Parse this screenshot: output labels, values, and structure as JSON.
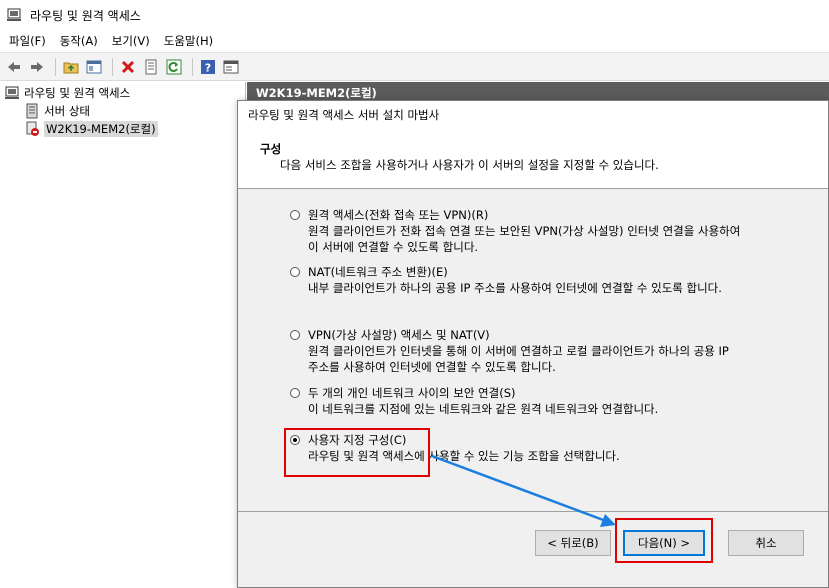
{
  "window": {
    "title": "라우팅 및 원격 액세스",
    "icon": "routing-remote-access-icon"
  },
  "menu": [
    "파일(F)",
    "동작(A)",
    "보기(V)",
    "도움말(H)"
  ],
  "toolbar": {
    "buttons": [
      "back-arrow-icon",
      "forward-arrow-icon",
      "up-folder-icon",
      "show-hide-tree-icon",
      "delete-icon",
      "properties-icon",
      "refresh-icon",
      "help-icon",
      "action-pane-icon"
    ]
  },
  "tree": {
    "root": "라우팅 및 원격 액세스",
    "items": [
      "서버 상태",
      "W2K19-MEM2(로컬)"
    ]
  },
  "right_header": "W2K19-MEM2(로컬)",
  "wizard": {
    "title": "라우팅 및 원격 액세스 서버 설치 마법사",
    "heading": "구성",
    "subheading": "다음 서비스 조합을 사용하거나 사용자가 이 서버의 설정을 지정할 수 있습니다.",
    "options": [
      {
        "label": "원격 액세스(전화 접속 또는 VPN)(R)",
        "desc": [
          "원격 클라이언트가 전화 접속 연결 또는 보안된 VPN(가상 사설망) 인터넷 연결을 사용하여",
          "이 서버에 연결할 수 있도록 합니다."
        ],
        "checked": false
      },
      {
        "label": "NAT(네트워크 주소 변환)(E)",
        "desc": [
          "내부 클라이언트가 하나의 공용 IP 주소를 사용하여 인터넷에 연결할 수 있도록 합니다."
        ],
        "checked": false
      },
      {
        "label": "VPN(가상 사설망) 액세스 및 NAT(V)",
        "desc": [
          "원격 클라이언트가 인터넷을 통해 이 서버에 연결하고 로컬 클라이언트가 하나의 공용 IP",
          "주소를 사용하여 인터넷에 연결할 수 있도록 합니다."
        ],
        "checked": false
      },
      {
        "label": "두 개의 개인 네트워크 사이의 보안 연결(S)",
        "desc": [
          "이 네트워크를 지점에 있는 네트워크와 같은 원격 네트워크와 연결합니다."
        ],
        "checked": false
      },
      {
        "label": "사용자 지정 구성(C)",
        "desc": [
          "라우팅 및 원격 액세스에 사용할 수 있는 기능 조합을 선택합니다."
        ],
        "checked": true
      }
    ],
    "buttons": {
      "back": "< 뒤로(B)",
      "next": "다음(N) >",
      "cancel": "취소"
    }
  },
  "colors": {
    "highlight": "#e00000",
    "arrow": "#1a7fe0",
    "header_bg": "#5c5c5c",
    "primary_border": "#0078d7"
  }
}
